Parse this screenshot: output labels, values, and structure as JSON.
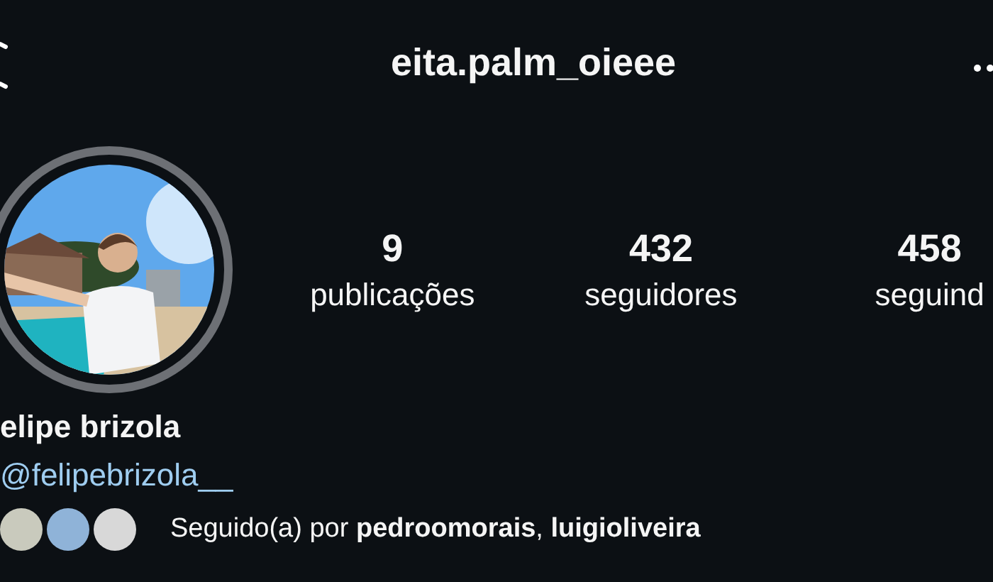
{
  "header": {
    "username": "eita.palm_oieee"
  },
  "profile": {
    "name": "elipe brizola",
    "handle": "@felipebrizola__"
  },
  "stats": [
    {
      "value": "9",
      "label": "publicações"
    },
    {
      "value": "432",
      "label": "seguidores"
    },
    {
      "value": "458",
      "label": "seguind"
    }
  ],
  "followed_by": {
    "text": "Seguido(a) por **pedroomorais**, **luigioliveira**"
  }
}
